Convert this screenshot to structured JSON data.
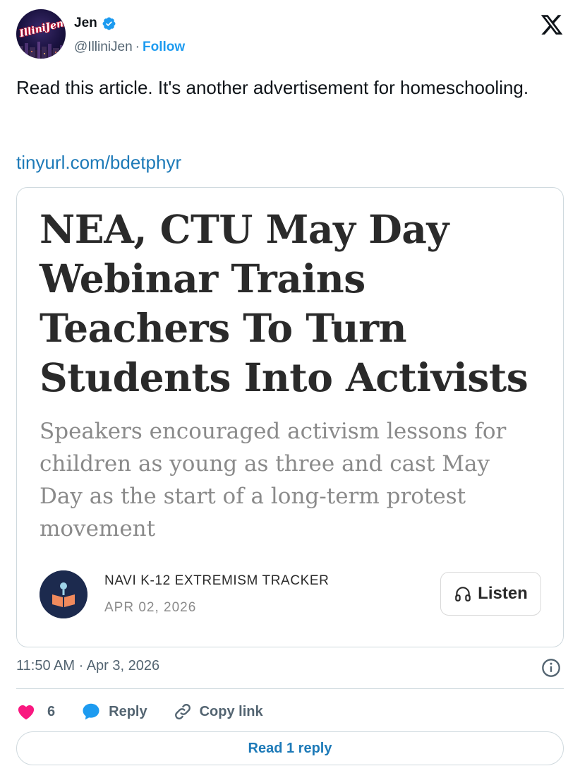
{
  "author": {
    "display_name": "Jen",
    "handle": "@IlliniJen",
    "separator": "·",
    "follow_label": "Follow",
    "avatar_text": "IlliniJen",
    "verified": true
  },
  "tweet": {
    "text": "Read this article. It's another advertisement for homeschooling.",
    "link": "tinyurl.com/bdetphyr",
    "timestamp": "11:50 AM · Apr 3, 2026"
  },
  "card": {
    "title": "NEA, CTU May Day Webinar Trains Teachers To Turn Students Into Activists",
    "subtitle": "Speakers encouraged activism lessons for children as young as three and cast May Day as the start of a long-term protest movement",
    "publication": "NAVI K-12 EXTREMISM TRACKER",
    "date": "APR 02, 2026",
    "listen_label": "Listen"
  },
  "actions": {
    "like_count": "6",
    "reply_label": "Reply",
    "copy_link_label": "Copy link"
  },
  "read_replies": {
    "prefix": "Read",
    "count": "1",
    "suffix": "reply"
  },
  "colors": {
    "accent_blue": "#1d9bf0",
    "link_blue": "#1d7ab8",
    "like_pink": "#f91880",
    "muted": "#536471",
    "border": "#cfd9de",
    "publication_logo_bg": "#1c2a4e"
  },
  "icons": [
    "verified-badge-icon",
    "x-logo-icon",
    "headphones-icon",
    "info-icon",
    "heart-icon",
    "reply-bubble-icon",
    "link-icon"
  ]
}
